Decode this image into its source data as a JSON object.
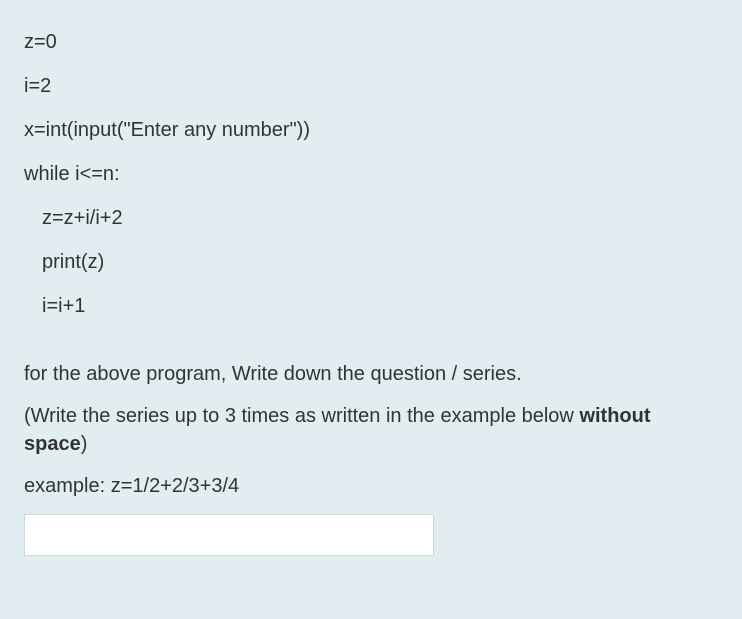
{
  "code": {
    "l1": "z=0",
    "l2": "i=2",
    "l3": "x=int(input(\"Enter any number\"))",
    "l4": "while i<=n:",
    "l5": "z=z+i/i+2",
    "l6": "print(z)",
    "l7": "i=i+1"
  },
  "question": {
    "line1": "for the above program, Write down the question / series.",
    "line2_pre": "(Write the series up to 3 times as written in the example below ",
    "line2_bold": "without space",
    "line2_post": ")",
    "example": "example: z=1/2+2/3+3/4"
  },
  "answer": {
    "value": ""
  }
}
